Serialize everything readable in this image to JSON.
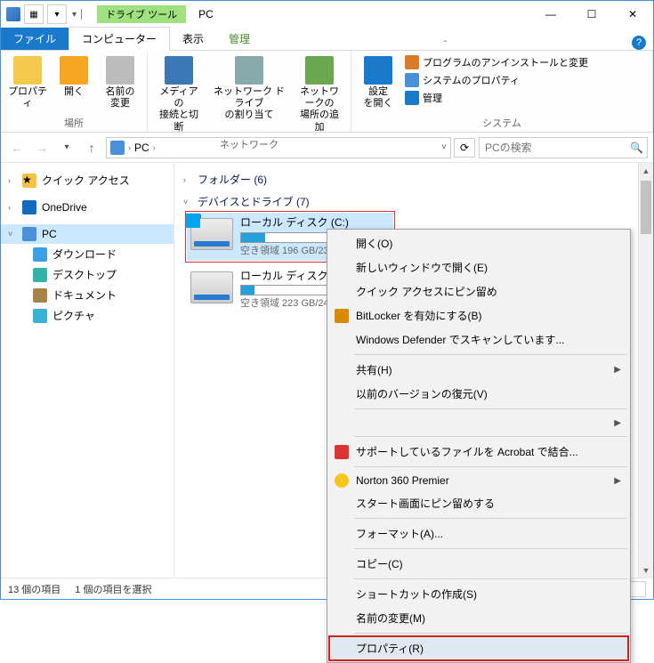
{
  "title": "PC",
  "toolstab": "ドライブ ツール",
  "tabs": {
    "file": "ファイル",
    "computer": "コンピューター",
    "view": "表示",
    "manage": "管理"
  },
  "ribbon": {
    "group1": {
      "label": "場所",
      "properties": "プロパティ",
      "open": "開く",
      "rename": "名前の\n変更"
    },
    "group2": {
      "label": "ネットワーク",
      "media": "メディアの\n接続と切断",
      "map": "ネットワーク ドライブ\nの割り当て",
      "addloc": "ネットワークの\n場所の追加"
    },
    "group3": {
      "label": "システム",
      "settings": "設定\nを開く",
      "uninstall": "プログラムのアンインストールと変更",
      "sysprop": "システムのプロパティ",
      "sysmanage": "管理"
    }
  },
  "address": {
    "root": "PC"
  },
  "search_placeholder": "PCの検索",
  "nav": {
    "quick": "クイック アクセス",
    "onedrive": "OneDrive",
    "pc": "PC",
    "downloads": "ダウンロード",
    "desktop": "デスクトップ",
    "documents": "ドキュメント",
    "pictures": "ピクチャ"
  },
  "sections": {
    "folders": "フォルダー (6)",
    "devices": "デバイスとドライブ (7)"
  },
  "drives": {
    "c": {
      "name": "ローカル ディスク (C:)",
      "free": "空き領域 196 GB/23…",
      "fill_pct": 18
    },
    "e": {
      "name": "ローカル ディスク (E:)",
      "free": "空き領域 223 GB/24…",
      "fill_pct": 10
    }
  },
  "status": {
    "count": "13 個の項目",
    "selected": "1 個の項目を選択"
  },
  "context": {
    "open": "開く(O)",
    "new_window": "新しいウィンドウで開く(E)",
    "pin_quick": "クイック アクセスにピン留め",
    "bitlocker": "BitLocker を有効にする(B)",
    "defender": "Windows Defender でスキャンしています...",
    "share": "共有(H)",
    "restore": "以前のバージョンの復元(V)",
    "acrobat": "サポートしているファイルを Acrobat で結合...",
    "norton": "Norton 360 Premier",
    "pin_start": "スタート画面にピン留めする",
    "format": "フォーマット(A)...",
    "copy": "コピー(C)",
    "shortcut": "ショートカットの作成(S)",
    "rename": "名前の変更(M)",
    "properties": "プロパティ(R)"
  }
}
